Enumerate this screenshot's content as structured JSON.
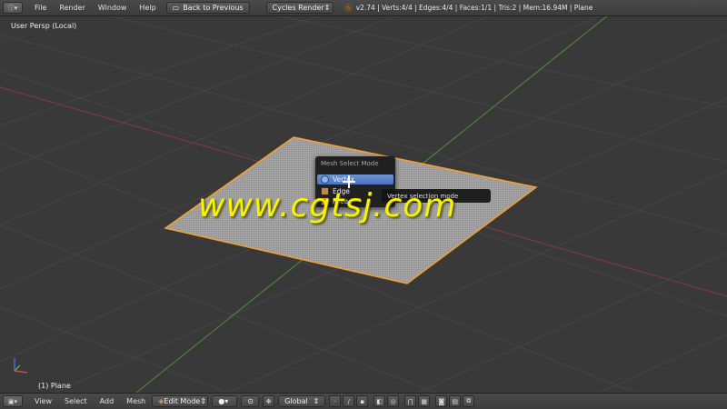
{
  "top_bar": {
    "menus": [
      "File",
      "Render",
      "Window",
      "Help"
    ],
    "back_button": "Back to Previous",
    "render_engine": "Cycles Render",
    "stats": "v2.74 | Verts:4/4 | Edges:4/4 | Faces:1/1 | Tris:2 | Mem:16.94M | Plane"
  },
  "viewport": {
    "view_label": "User Persp (Local)",
    "object_label": "(1) Plane"
  },
  "mesh_select_menu": {
    "title": "Mesh Select Mode",
    "items": [
      "Vertex",
      "Edge",
      "Face"
    ],
    "tooltip": "Vertex selection mode"
  },
  "watermark": "www.cgtsj.com",
  "bottom_bar": {
    "menus": [
      "View",
      "Select",
      "Add",
      "Mesh"
    ],
    "mode": "Edit Mode",
    "orientation": "Global"
  },
  "colors": {
    "background": "#393939",
    "selection_outline": "#f7a02a",
    "x_axis": "#9a3a3a",
    "y_axis": "#4c9a3a",
    "active_item": "#5a82cc",
    "watermark": "#f6f200"
  }
}
